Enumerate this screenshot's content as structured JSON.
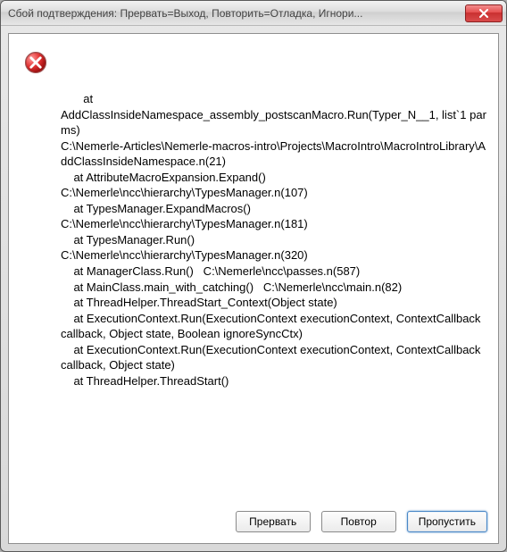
{
  "titlebar": {
    "title": "Сбой подтверждения: Прервать=Выход, Повторить=Отладка, Игнори..."
  },
  "icons": {
    "close": "close-x-icon",
    "error": "error-circle-icon"
  },
  "message": {
    "text": "       at\nAddClassInsideNamespace_assembly_postscanMacro.Run(Typer_N__1, list`1 parms)\nC:\\Nemerle-Articles\\Nemerle-macros-intro\\Projects\\MacroIntro\\MacroIntroLibrary\\AddClassInsideNamespace.n(21)\n    at AttributeMacroExpansion.Expand()\nC:\\Nemerle\\ncc\\hierarchy\\TypesManager.n(107)\n    at TypesManager.ExpandMacros()\nC:\\Nemerle\\ncc\\hierarchy\\TypesManager.n(181)\n    at TypesManager.Run()\nC:\\Nemerle\\ncc\\hierarchy\\TypesManager.n(320)\n    at ManagerClass.Run()   C:\\Nemerle\\ncc\\passes.n(587)\n    at MainClass.main_with_catching()   C:\\Nemerle\\ncc\\main.n(82)\n    at ThreadHelper.ThreadStart_Context(Object state)\n    at ExecutionContext.Run(ExecutionContext executionContext, ContextCallback callback, Object state, Boolean ignoreSyncCtx)\n    at ExecutionContext.Run(ExecutionContext executionContext, ContextCallback callback, Object state)\n    at ThreadHelper.ThreadStart()"
  },
  "buttons": {
    "abort": "Прервать",
    "retry": "Повтор",
    "ignore": "Пропустить"
  }
}
